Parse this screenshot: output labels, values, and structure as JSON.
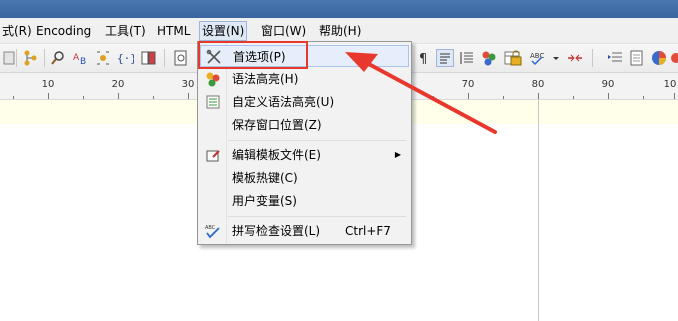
{
  "menubar": {
    "items": [
      {
        "label": "式(R)"
      },
      {
        "label": "Encoding"
      },
      {
        "label": "工具(T)"
      },
      {
        "label": "HTML"
      },
      {
        "label": "设置(N)"
      },
      {
        "label": "窗口(W)"
      },
      {
        "label": "帮助(H)"
      }
    ]
  },
  "ruler": {
    "labels": [
      "10",
      "20",
      "30",
      "70",
      "80",
      "90",
      "10"
    ]
  },
  "settings_menu": {
    "items": [
      {
        "label": "首选项(P)",
        "icon": "wrench-screwdriver-icon"
      },
      {
        "label": "语法高亮(H)",
        "icon": "syntax-highlight-icon"
      },
      {
        "label": "自定义语法高亮(U)",
        "icon": "custom-syntax-icon"
      },
      {
        "label": "保存窗口位置(Z)",
        "icon": ""
      },
      {
        "label": "编辑模板文件(E)",
        "icon": "edit-template-icon"
      },
      {
        "label": "模板热键(C)",
        "icon": ""
      },
      {
        "label": "用户变量(S)",
        "icon": ""
      },
      {
        "label": "拼写检查设置(L)",
        "icon": "spell-check-icon",
        "shortcut": "Ctrl+F7"
      }
    ]
  },
  "colors": {
    "annotation": "#e8382e",
    "menu_highlight": "#e5eefa"
  }
}
